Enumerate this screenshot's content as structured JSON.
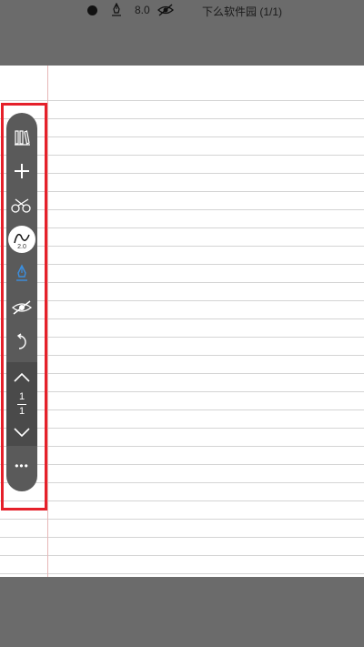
{
  "status": {
    "pen_size": "8.0",
    "doc_title": "下么软件园 (1/1)"
  },
  "toolbar": {
    "items": [
      {
        "name": "library-button",
        "icon": "books-icon"
      },
      {
        "name": "add-button",
        "icon": "plus-icon"
      },
      {
        "name": "scissors-button",
        "icon": "scissors-icon"
      },
      {
        "name": "brush-button",
        "icon": "brush-wave-icon",
        "size_label": "2.0"
      },
      {
        "name": "pen-button",
        "icon": "fountain-pen-icon",
        "color": "#3b8fe0"
      },
      {
        "name": "hide-button",
        "icon": "eye-slash-icon"
      },
      {
        "name": "undo-button",
        "icon": "undo-icon"
      }
    ],
    "pager": {
      "current": "1",
      "total": "1"
    },
    "more_label": "•••"
  },
  "colors": {
    "background": "#6b6b6b",
    "toolbar": "#5a5a5a",
    "highlight": "#e5202a",
    "paper_line": "#d4d4d4",
    "margin_line": "#e6b7b7",
    "accent": "#3b8fe0"
  }
}
